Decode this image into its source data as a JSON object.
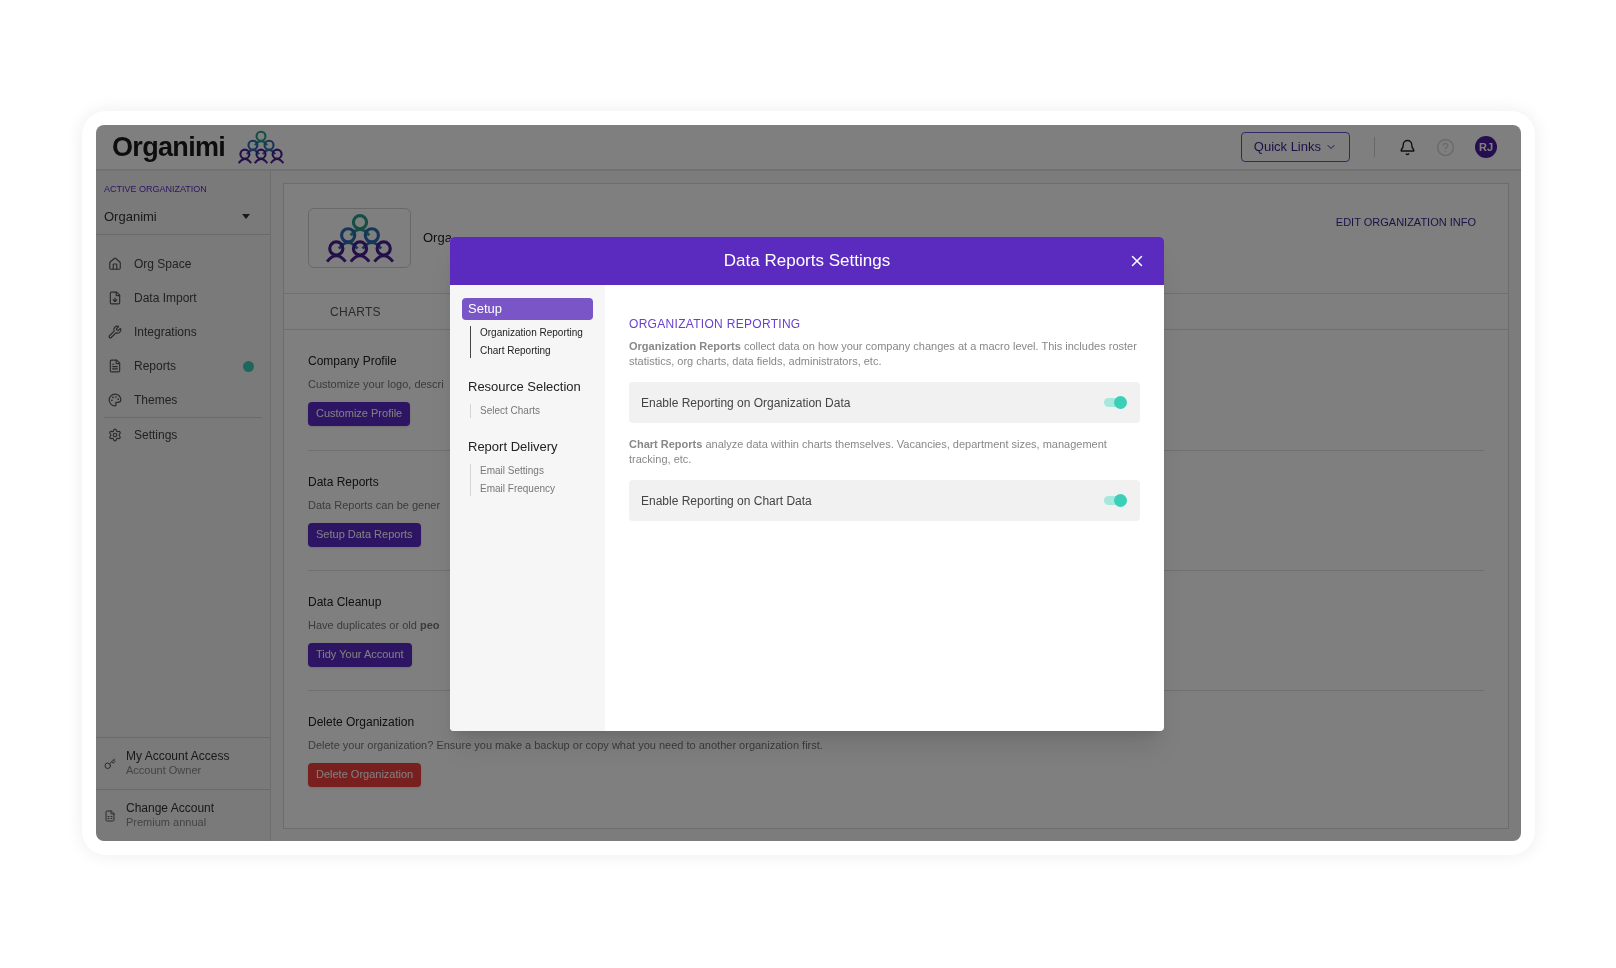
{
  "header": {
    "logo_text": "Organimi",
    "quick_links": "Quick Links",
    "avatar": "RJ"
  },
  "sidebar": {
    "org_label": "ACTIVE ORGANIZATION",
    "org_name": "Organimi",
    "items": [
      {
        "label": "Org Space",
        "dot": false
      },
      {
        "label": "Data Import",
        "dot": false
      },
      {
        "label": "Integrations",
        "dot": false
      },
      {
        "label": "Reports",
        "dot": true
      },
      {
        "label": "Themes",
        "dot": false
      },
      {
        "label": "Settings",
        "dot": false
      }
    ],
    "footer": [
      {
        "title": "My Account Access",
        "subtitle": "Account Owner"
      },
      {
        "title": "Change Account",
        "subtitle": "Premium annual"
      }
    ]
  },
  "content": {
    "org_name": "Orga",
    "edit_link": "EDIT ORGANIZATION INFO",
    "tab": "CHARTS",
    "sections": [
      {
        "title": "Company Profile",
        "description": "Customize your logo, descri",
        "button": "Customize Profile",
        "kind": "primary"
      },
      {
        "title": "Data Reports",
        "description": "Data Reports can be gener",
        "button": "Setup Data Reports",
        "kind": "primary"
      },
      {
        "title": "Data Cleanup",
        "description": "Have duplicates or old **peo**",
        "button": "Tidy Your Account",
        "kind": "primary"
      },
      {
        "title": "Delete Organization",
        "description": "Delete your organization? Ensure you make a backup or copy what you need to another organization first.",
        "button": "Delete Organization",
        "kind": "danger"
      }
    ]
  },
  "modal": {
    "title": "Data Reports Settings",
    "nav": [
      {
        "label": "Setup",
        "selected": true,
        "children": [
          "Organization Reporting",
          "Chart Reporting"
        ]
      },
      {
        "label": "Resource Selection",
        "selected": false,
        "children": [
          "Select Charts"
        ]
      },
      {
        "label": "Report Delivery",
        "selected": false,
        "children": [
          "Email Settings",
          "Email Frequency"
        ]
      }
    ],
    "heading": "ORGANIZATION REPORTING",
    "blocks": [
      {
        "kind": "text",
        "text": "**Organization Reports** collect data on how your company changes at a macro level. This includes roster statistics, org charts, data fields, administrators, etc."
      },
      {
        "kind": "toggle",
        "label": "Enable Reporting on Organization Data",
        "on": true
      },
      {
        "kind": "text",
        "text": "**Chart Reports** analyze data within charts themselves. Vacancies, department sizes, management tracking, etc."
      },
      {
        "kind": "toggle",
        "label": "Enable Reporting on Chart Data",
        "on": true
      }
    ]
  }
}
